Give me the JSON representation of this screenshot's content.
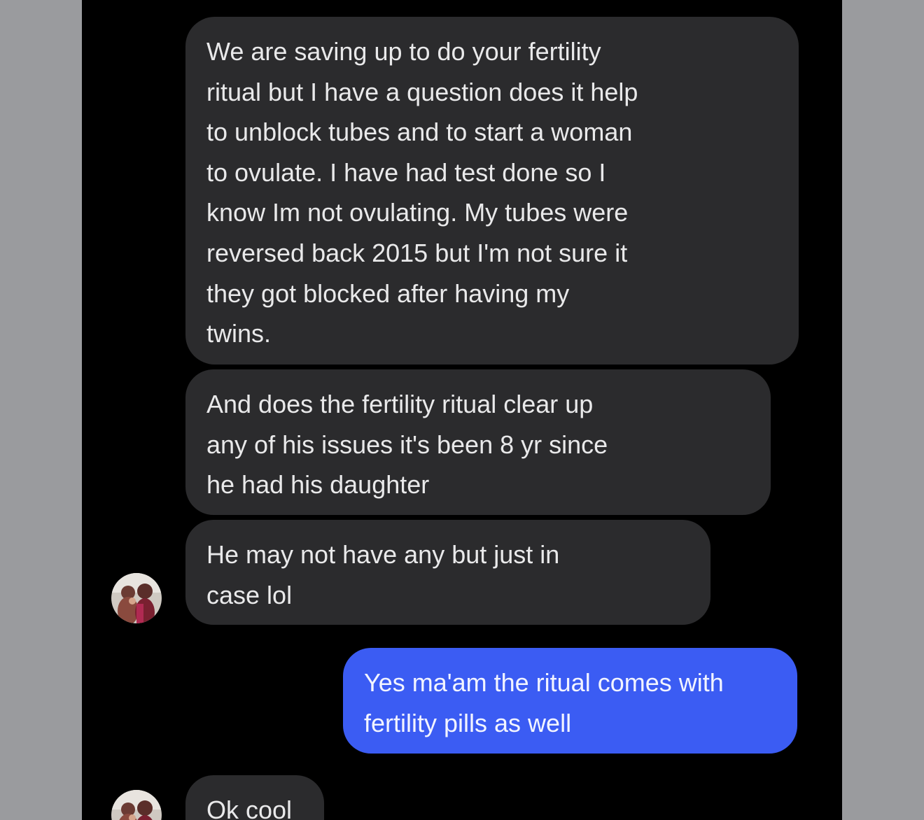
{
  "conversation": {
    "messages": [
      {
        "sender": "them",
        "lines": [
          "We are saving up to do your fertility",
          "ritual but I have a question does it help",
          "to unblock tubes and to start a woman",
          "to ovulate. I have had test done so I",
          "know Im not ovulating. My tubes were",
          "reversed back 2015 but I'm not sure it",
          "they got blocked after having my",
          "twins."
        ]
      },
      {
        "sender": "them",
        "lines": [
          "And does the fertility ritual clear up",
          "any of his issues it's been 8 yr since",
          "he had his daughter"
        ]
      },
      {
        "sender": "them",
        "lines": [
          "He may not have any but just in",
          "case lol"
        ]
      },
      {
        "sender": "me",
        "lines": [
          "Yes ma'am the ritual comes with",
          "fertility pills as well"
        ]
      },
      {
        "sender": "them",
        "lines": [
          "Ok cool"
        ]
      }
    ]
  },
  "avatars": [
    {
      "icon": "contact-avatar-icon",
      "kind": "photo"
    },
    {
      "icon": "contact-avatar-icon",
      "kind": "photo"
    }
  ],
  "colors": {
    "outer_background": "#9a9b9e",
    "chat_background": "#000000",
    "incoming_bubble": "#2b2b2d",
    "outgoing_bubble": "#3b5cf3",
    "incoming_text": "#e9e9ea",
    "outgoing_text": "#f2f4ff"
  }
}
